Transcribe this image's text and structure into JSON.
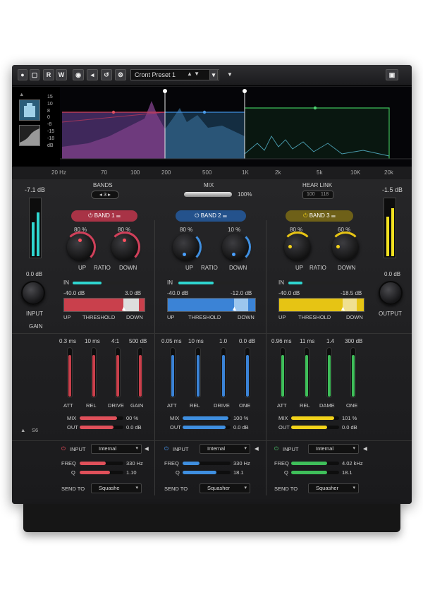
{
  "toolbar": {
    "buttons": [
      "R",
      "W"
    ],
    "preset_name": "Cront Preset 1",
    "dropdown_caret": "▼"
  },
  "spectrum": {
    "db_scale": [
      "15",
      "10",
      "8",
      "0",
      "-8",
      "-15",
      "-18",
      "dB"
    ],
    "freq_labels": [
      "20 Hz",
      "70",
      "100",
      "200",
      "500",
      "1K",
      "2k",
      "5k",
      "10K",
      "20k"
    ]
  },
  "global": {
    "left_meter_value": "-7.1 dB",
    "right_meter_value": "-1.5 dB",
    "input_gain_value": "0.0 dB",
    "input_label": "INPUT",
    "output_gain_value": "0.0 dB",
    "output_label": "OUTPUT",
    "bands_label": "BANDS",
    "bands_value": "3",
    "mix_label": "MIX",
    "mix_value": "100%",
    "link_label": "HEAR LINK",
    "link_left": "100",
    "link_right": "118",
    "gain_label": "GAIN",
    "s6_label": "S6"
  },
  "bands": [
    {
      "title": "BAND 1",
      "color": "#e0505a",
      "up_ratio": "80 %",
      "down_ratio": "80 %",
      "knob_up_label": "UP",
      "knob_mid_label": "RATIO",
      "knob_down_label": "DOWN",
      "in_label": "IN",
      "in_level": 0.45,
      "thr_low": "-40.0 dB",
      "thr_high": "3.0 dB",
      "thr_up": "UP",
      "thr_label": "THRESHOLD",
      "thr_down": "DOWN",
      "attack": "0.3 ms",
      "release": "10 ms",
      "drive": "4:1",
      "gain": "500 dB",
      "fader_labels": [
        "ATT",
        "REL",
        "DRIVE",
        "GAIN"
      ],
      "fader_levels": [
        0.85,
        0.85,
        0.85,
        0.85
      ],
      "mix_label": "MIX",
      "mix_value": "00 %",
      "mix_level": 0.85,
      "out_label": "OUT",
      "out_value": "0.0 dB",
      "out_level": 0.78,
      "input_label": "INPUT",
      "input_source": "Internal",
      "freq_label": "FREQ",
      "freq_value": "330 Hz",
      "freq_level": 0.6,
      "q_label": "Q",
      "q_value": "1.10",
      "q_level": 0.7,
      "send_label": "SEND TO",
      "send_target": "Squashe"
    },
    {
      "title": "BAND 2",
      "color": "#3f8fe0",
      "up_ratio": "80 %",
      "down_ratio": "10 %",
      "knob_up_label": "UP",
      "knob_mid_label": "RATIO",
      "knob_down_label": "DOWN",
      "in_label": "IN",
      "in_level": 0.5,
      "thr_low": "-40.0 dB",
      "thr_high": "-12.0 dB",
      "thr_up": "UP",
      "thr_label": "THRESHOLD",
      "thr_down": "DOWN",
      "attack": "0.05 ms",
      "release": "10 ms",
      "drive": "1.0",
      "gain": "0.0 dB",
      "fader_labels": [
        "ATT",
        "REL",
        "DRIVE",
        "ONE"
      ],
      "fader_levels": [
        0.85,
        0.85,
        0.85,
        0.85
      ],
      "mix_label": "MIX",
      "mix_value": "100 %",
      "mix_level": 0.95,
      "out_label": "OUT",
      "out_value": "0.0 dB",
      "out_level": 0.9,
      "input_label": "INPUT",
      "input_source": "Internal",
      "freq_label": "FREQ",
      "freq_value": "330 Hz",
      "freq_level": 0.35,
      "q_label": "Q",
      "q_value": "18.1",
      "q_level": 0.7,
      "send_label": "SEND TO",
      "send_target": "Squasher"
    },
    {
      "title": "BAND 3",
      "color": "#f2d21a",
      "up_ratio": "80 %",
      "down_ratio": "60 %",
      "knob_up_label": "UP",
      "knob_mid_label": "RATIO",
      "knob_down_label": "DOWN",
      "in_label": "IN",
      "in_level": 0.2,
      "thr_low": "-40.0 dB",
      "thr_high": "-18.5 dB",
      "thr_up": "UP",
      "thr_label": "THRESHOLD",
      "thr_down": "DOWN",
      "attack": "0.96 ms",
      "release": "11 ms",
      "drive": "1.4",
      "gain": "300 dB",
      "fader_labels": [
        "ATT",
        "REL",
        "DAME",
        "ONE"
      ],
      "fader_levels": [
        0.85,
        0.85,
        0.85,
        0.85
      ],
      "mix_label": "MIX",
      "mix_value": "101 %",
      "mix_level": 0.9,
      "out_label": "OUT",
      "out_value": "0.0 dB",
      "out_level": 0.75,
      "input_label": "INPUT",
      "input_source": "Internal",
      "freq_label": "FREQ",
      "freq_value": "4.02 kHz",
      "freq_level": 0.75,
      "q_label": "Q",
      "q_value": "18.1",
      "q_level": 0.75,
      "send_label": "SEND TO",
      "send_target": "Squasher"
    }
  ],
  "band_colors_fill": [
    "#c9404c",
    "#3b83d6",
    "#e6c414"
  ],
  "green_band": {
    "color": "#3fbf5a"
  }
}
